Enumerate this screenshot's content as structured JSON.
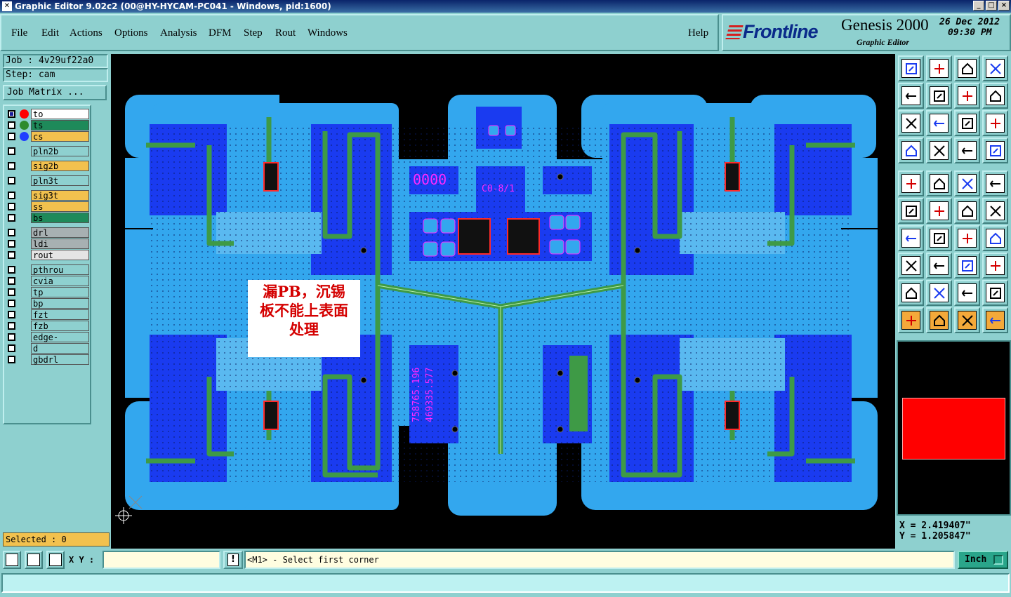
{
  "window": {
    "title": "Graphic Editor 9.02c2 (00@HY-HYCAM-PC041 - Windows, pid:1600)",
    "controls": {
      "minimize": "_",
      "maximize": "□",
      "close": "×"
    }
  },
  "menu": {
    "items": [
      "File",
      "Edit",
      "Actions",
      "Options",
      "Analysis",
      "DFM",
      "Step",
      "Rout",
      "Windows"
    ],
    "help": "Help"
  },
  "brand": {
    "logo": "Frontline",
    "product": "Genesis 2000",
    "subtitle": "Graphic Editor",
    "date": "26 Dec 2012",
    "time": "09:30 PM"
  },
  "job": {
    "job_label": "Job : 4v29uf22a0",
    "step_label": "Step: cam",
    "matrix_button": "Job Matrix ..."
  },
  "layers": [
    {
      "name": "to",
      "bg": "#ffffff",
      "dot": "#ff0000",
      "checked": true
    },
    {
      "name": "ts",
      "bg": "#1e8a5a",
      "dot": "#2e8b2e",
      "checked": false
    },
    {
      "name": "cs",
      "bg": "#f2c14e",
      "dot": "#1f3fff",
      "checked": false
    },
    {
      "name": "pln2b",
      "bg": "#8ed0cf",
      "checked": false
    },
    {
      "name": "sig2b",
      "bg": "#f2c14e",
      "checked": false
    },
    {
      "name": "pln3t",
      "bg": "#8ed0cf",
      "checked": false
    },
    {
      "name": "sig3t",
      "bg": "#f2c14e",
      "checked": false
    },
    {
      "name": "ss",
      "bg": "#f2c14e",
      "checked": false
    },
    {
      "name": "bs",
      "bg": "#1e8a5a",
      "checked": false
    },
    {
      "name": "drl",
      "bg": "#a7b0b2",
      "checked": false
    },
    {
      "name": "ldi",
      "bg": "#a7b0b2",
      "checked": false
    },
    {
      "name": "rout",
      "bg": "#e4e4e4",
      "checked": false
    },
    {
      "name": "pthrou",
      "bg": "#8ed0cf",
      "checked": false
    },
    {
      "name": "cvia",
      "bg": "#8ed0cf",
      "checked": false
    },
    {
      "name": "tp",
      "bg": "#8ed0cf",
      "checked": false
    },
    {
      "name": "bp",
      "bg": "#8ed0cf",
      "checked": false
    },
    {
      "name": "fzt",
      "bg": "#8ed0cf",
      "checked": false
    },
    {
      "name": "fzb",
      "bg": "#8ed0cf",
      "checked": false
    },
    {
      "name": "edge-plated",
      "bg": "#8ed0cf",
      "checked": false
    },
    {
      "name": "d",
      "bg": "#8ed0cf",
      "checked": false
    },
    {
      "name": "gbdrl",
      "bg": "#8ed0cf",
      "checked": false
    }
  ],
  "selection": {
    "label": "Selected : 0"
  },
  "canvas": {
    "annotation_lines": [
      "漏PB，沉锡",
      "板不能上表面",
      "处理"
    ],
    "board_text_1": "0000",
    "board_text_2": "C0-8/1",
    "board_text_3": "758765.196",
    "board_text_4": "469335.577"
  },
  "coords": {
    "x": "X = 2.419407\"",
    "y": "Y = 1.205847\""
  },
  "bottom": {
    "xy_label": "X Y :",
    "xy_value": "",
    "warn": "!",
    "prompt": "<M1> - Select first corner",
    "unit": "Inch"
  },
  "colors": {
    "panel": "#8ed0cf",
    "board_light": "#33a7ee",
    "board_dark": "#1a3bf0",
    "trace": "#3e9a46",
    "annotation_text": "#d40000",
    "preview_fill": "#ff0000"
  },
  "tools": [
    "zoom-home-icon",
    "zoom-home2-icon",
    "home-icon",
    "window-icon",
    "pan-left-icon",
    "pan-right-icon",
    "zoom-out-icon",
    "zoom-in-icon",
    "fit-icon",
    "center-icon",
    "ratio-icon",
    "help-icon",
    "measure-icon",
    "grid-icon",
    "snap-icon",
    "snap2-icon",
    "screen-icon",
    "polygon-icon",
    "ruler-icon",
    "fill-icon",
    "connect-icon",
    "cross-icon",
    "line-icon",
    "arrow-line-icon",
    "angle-icon",
    "slash-icon",
    "arc-icon",
    "feature-icon",
    "pad-icon",
    "trace-icon",
    "dimension-icon",
    "group-icon",
    "triangle-icon",
    "triangle2-icon",
    "shape-icon",
    "shape2-icon",
    "select-icon",
    "select2-icon",
    "select3-icon",
    "route-icon"
  ]
}
